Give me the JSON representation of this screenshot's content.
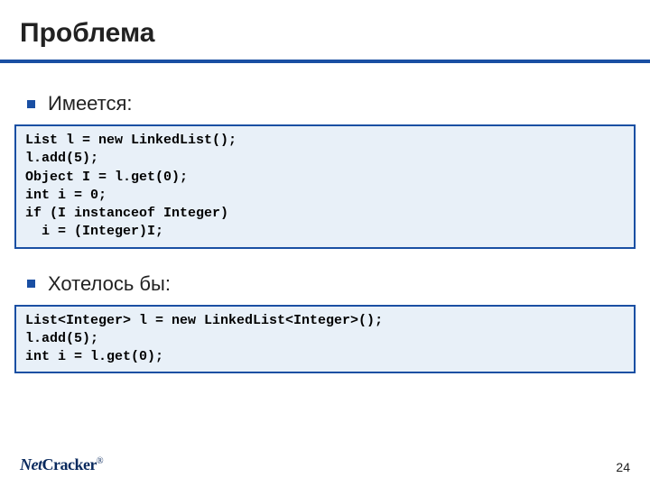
{
  "title": "Проблема",
  "bullets": {
    "b1": "Имеется:",
    "b2": "Хотелось бы:"
  },
  "code1": "List l = new LinkedList();\nl.add(5);\nObject I = l.get(0);\nint i = 0;\nif (I instanceof Integer)\n  i = (Integer)I;",
  "code2": "List<Integer> l = new LinkedList<Integer>();\nl.add(5);\nint i = l.get(0);",
  "logo": {
    "part1": "Net",
    "part2": "Cracker",
    "mark": "®"
  },
  "page": "24"
}
